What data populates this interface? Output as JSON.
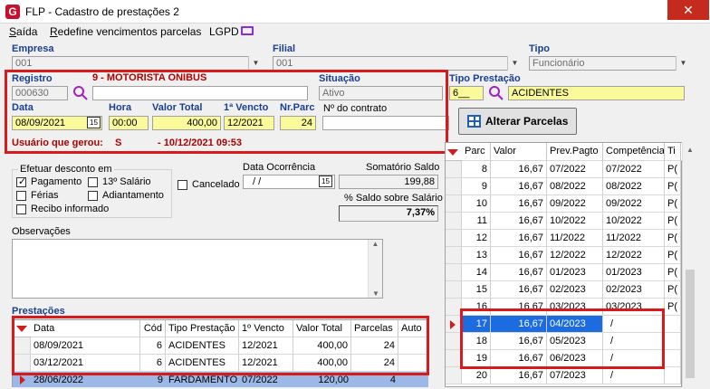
{
  "window": {
    "title": "FLP - Cadastro de prestações 2",
    "close": "✕"
  },
  "menu": [
    {
      "label_u": "S",
      "label_rest": "aída"
    },
    {
      "label_u": "R",
      "label_rest": "edefine vencimentos parcelas"
    },
    {
      "label_u": "",
      "label_rest": "LGPD"
    }
  ],
  "empresa": {
    "label": "Empresa",
    "value": "001"
  },
  "filial": {
    "label": "Filial",
    "value": "001"
  },
  "tipo": {
    "label": "Tipo",
    "value": "Funcionário"
  },
  "registro": {
    "label": "Registro",
    "code": "000630",
    "name_value": "",
    "title": "9 - MOTORISTA ONIBUS"
  },
  "situacao": {
    "label": "Situação",
    "value": "Ativo"
  },
  "tipo_prestacao": {
    "label": "Tipo Prestação",
    "code": "6__",
    "value": "ACIDENTES"
  },
  "data": {
    "label": "Data",
    "value": "08/09/2021",
    "cal": "15"
  },
  "hora": {
    "label": "Hora",
    "value": "00:00"
  },
  "valor_total": {
    "label": "Valor Total",
    "value": "400,00"
  },
  "vencto": {
    "label": "1ª Vencto",
    "value": "12/2021"
  },
  "nr_parc": {
    "label": "Nr.Parc",
    "value": "24"
  },
  "contrato": {
    "label": "Nº do contrato",
    "value": ""
  },
  "usuario": {
    "label": "Usuário que gerou:",
    "code": "S",
    "datetime": "- 10/12/2021 09:53"
  },
  "alterar_button": {
    "label": "Alterar Parcelas"
  },
  "desconto": {
    "legend": "Efetuar desconto em",
    "pagamento": {
      "label": "Pagamento",
      "checked": true
    },
    "decimo": {
      "label": "13º Salário",
      "checked": false
    },
    "ferias": {
      "label": "Férias",
      "checked": false
    },
    "adiantamento": {
      "label": "Adiantamento",
      "checked": false
    },
    "recibo": {
      "label": "Recibo informado",
      "checked": false
    }
  },
  "cancelado": {
    "label": "Cancelado",
    "checked": false
  },
  "ocorrencia": {
    "label": "Data Ocorrência",
    "value": "/ /",
    "cal": "15"
  },
  "somatorio": {
    "label": "Somatório Saldo",
    "value": "199,88"
  },
  "saldo_pct": {
    "label": "% Saldo sobre Salário",
    "value": "7,37%"
  },
  "observacoes": {
    "label": "Observações",
    "value": ""
  },
  "prestacoes": {
    "label": "Prestações",
    "columns": [
      "Data",
      "Cód",
      "Tipo Prestação",
      "1º Vencto",
      "Valor Total",
      "Parcelas",
      "Auto"
    ],
    "rows": [
      {
        "data": "08/09/2021",
        "cod": "6",
        "tipo": "ACIDENTES",
        "vencto": "12/2021",
        "valor": "400,00",
        "parcelas": "24",
        "auto": ""
      },
      {
        "data": "03/12/2021",
        "cod": "6",
        "tipo": "ACIDENTES",
        "vencto": "12/2021",
        "valor": "400,00",
        "parcelas": "24",
        "auto": ""
      },
      {
        "data": "28/06/2022",
        "cod": "9",
        "tipo": "FARDAMENTO",
        "vencto": "07/2022",
        "valor": "120,00",
        "parcelas": "4",
        "auto": ""
      }
    ]
  },
  "parcelas": {
    "columns": [
      "Parc",
      "Valor",
      "Prev.Pagto",
      "Competência",
      "Ti"
    ],
    "rows": [
      {
        "parc": "8",
        "valor": "16,67",
        "prev": "07/2022",
        "comp": "07/2022",
        "ti": "P("
      },
      {
        "parc": "9",
        "valor": "16,67",
        "prev": "08/2022",
        "comp": "08/2022",
        "ti": "P("
      },
      {
        "parc": "10",
        "valor": "16,67",
        "prev": "09/2022",
        "comp": "09/2022",
        "ti": "P("
      },
      {
        "parc": "11",
        "valor": "16,67",
        "prev": "10/2022",
        "comp": "10/2022",
        "ti": "P("
      },
      {
        "parc": "12",
        "valor": "16,67",
        "prev": "11/2022",
        "comp": "11/2022",
        "ti": "P("
      },
      {
        "parc": "13",
        "valor": "16,67",
        "prev": "12/2022",
        "comp": "12/2022",
        "ti": "P("
      },
      {
        "parc": "14",
        "valor": "16,67",
        "prev": "01/2023",
        "comp": "01/2023",
        "ti": "P("
      },
      {
        "parc": "15",
        "valor": "16,67",
        "prev": "02/2023",
        "comp": "02/2023",
        "ti": "P("
      },
      {
        "parc": "16",
        "valor": "16,67",
        "prev": "03/2023",
        "comp": "03/2023",
        "ti": "P("
      },
      {
        "parc": "17",
        "valor": "16,67",
        "prev": "04/2023",
        "comp": "/",
        "ti": ""
      },
      {
        "parc": "18",
        "valor": "16,67",
        "prev": "05/2023",
        "comp": "/",
        "ti": ""
      },
      {
        "parc": "19",
        "valor": "16,67",
        "prev": "06/2023",
        "comp": "/",
        "ti": ""
      },
      {
        "parc": "20",
        "valor": "16,67",
        "prev": "07/2023",
        "comp": "/",
        "ti": ""
      }
    ]
  }
}
